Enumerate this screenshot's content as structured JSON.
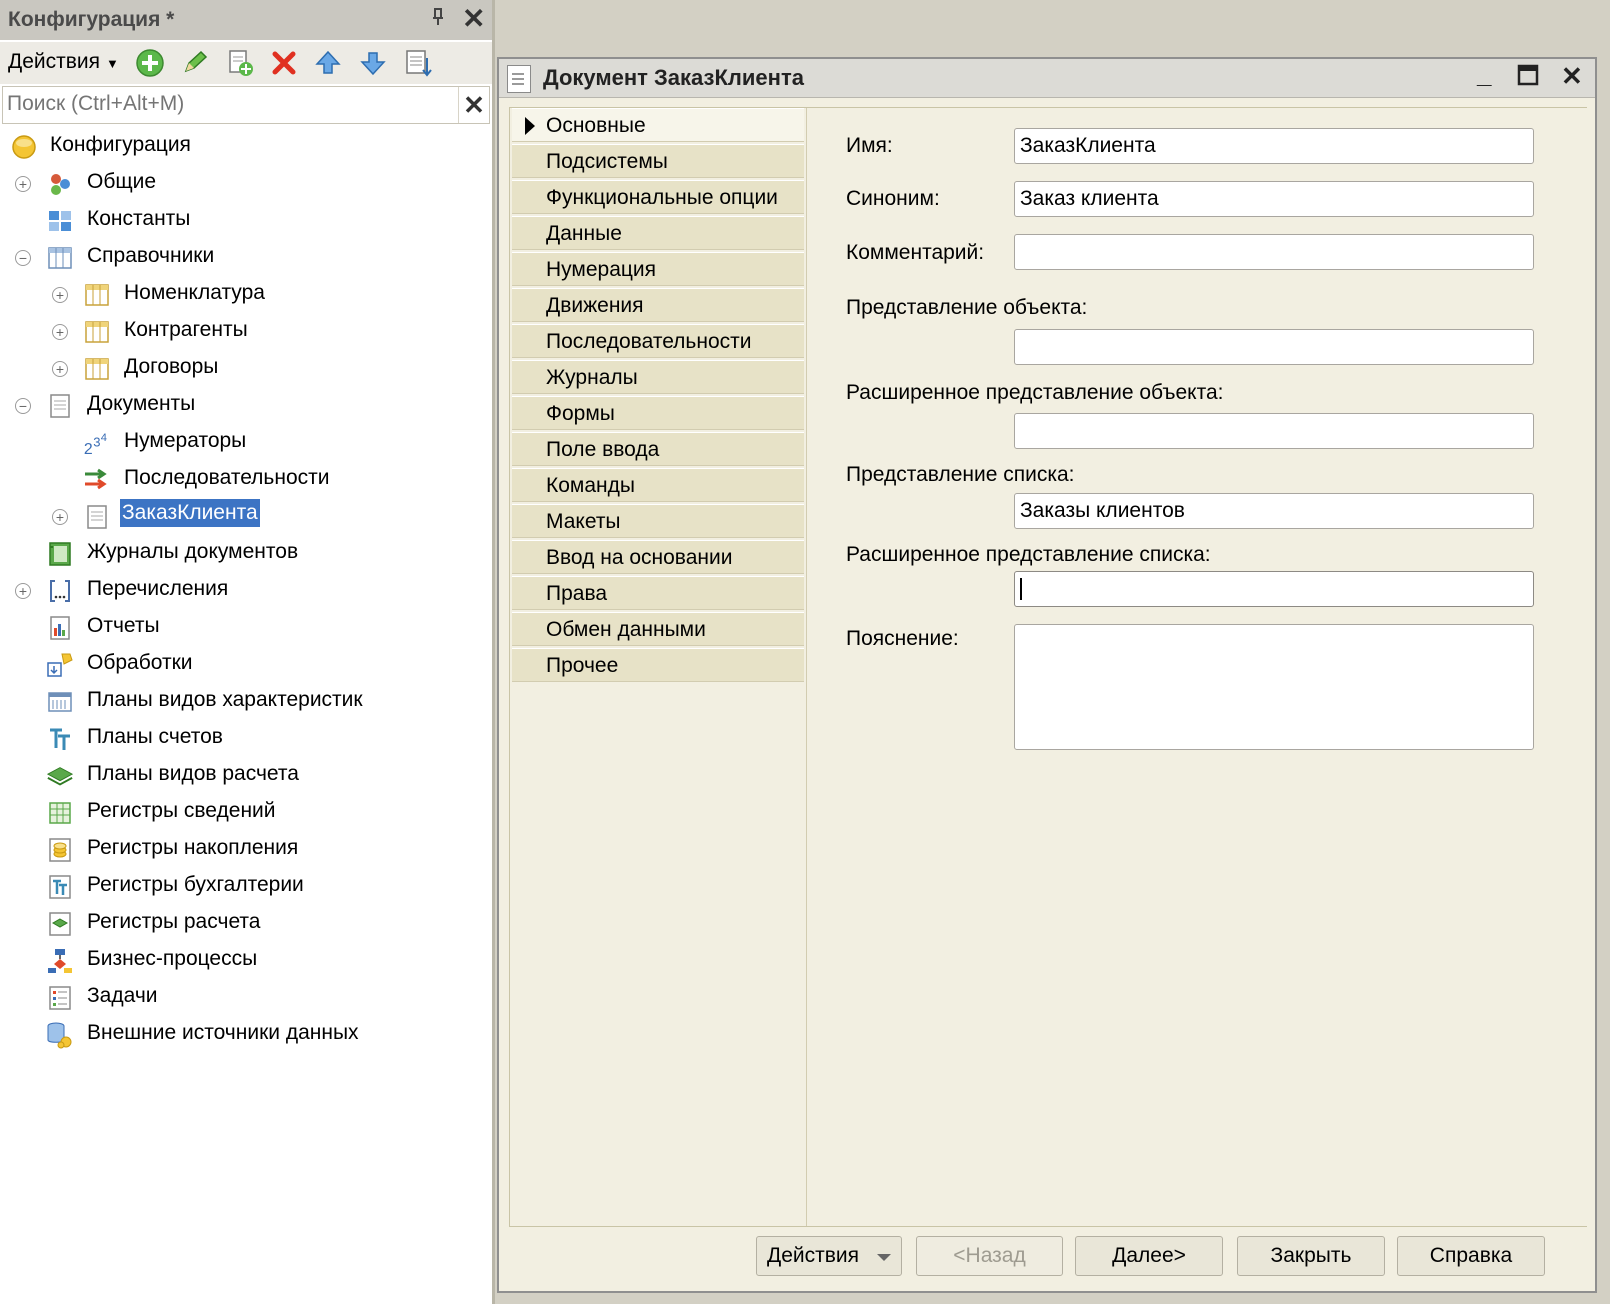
{
  "config_panel": {
    "title": "Конфигурация *",
    "toolbar": {
      "actions_label": "Действия",
      "icons": [
        "add-icon",
        "edit-icon",
        "copy-add-icon",
        "delete-icon",
        "move-up-icon",
        "move-down-icon",
        "sort-icon"
      ]
    },
    "search": {
      "placeholder": "Поиск (Ctrl+Alt+M)",
      "value": ""
    },
    "tree": [
      {
        "label": "Конфигурация",
        "icon": "configuration-icon",
        "level": 0,
        "expander": "none"
      },
      {
        "label": "Общие",
        "icon": "common-icon",
        "level": 1,
        "expander": "plus"
      },
      {
        "label": "Константы",
        "icon": "constants-icon",
        "level": 1,
        "expander": "none"
      },
      {
        "label": "Справочники",
        "icon": "catalogs-icon",
        "level": 1,
        "expander": "minus"
      },
      {
        "label": "Номенклатура",
        "icon": "catalog-icon",
        "level": 2,
        "expander": "plus"
      },
      {
        "label": "Контрагенты",
        "icon": "catalog-icon",
        "level": 2,
        "expander": "plus"
      },
      {
        "label": "Договоры",
        "icon": "catalog-icon",
        "level": 2,
        "expander": "plus"
      },
      {
        "label": "Документы",
        "icon": "documents-icon",
        "level": 1,
        "expander": "minus"
      },
      {
        "label": "Нумераторы",
        "icon": "numerators-icon",
        "level": 2,
        "expander": "none"
      },
      {
        "label": "Последовательности",
        "icon": "sequences-icon",
        "level": 2,
        "expander": "none"
      },
      {
        "label": "ЗаказКлиента",
        "icon": "document-icon",
        "level": 2,
        "expander": "plus",
        "selected": true
      },
      {
        "label": "Журналы документов",
        "icon": "journals-icon",
        "level": 1,
        "expander": "none"
      },
      {
        "label": "Перечисления",
        "icon": "enums-icon",
        "level": 1,
        "expander": "plus"
      },
      {
        "label": "Отчеты",
        "icon": "reports-icon",
        "level": 1,
        "expander": "none"
      },
      {
        "label": "Обработки",
        "icon": "dataprocessors-icon",
        "level": 1,
        "expander": "none"
      },
      {
        "label": "Планы видов характеристик",
        "icon": "chart-of-characteristic-types-icon",
        "level": 1,
        "expander": "none"
      },
      {
        "label": "Планы счетов",
        "icon": "charts-of-accounts-icon",
        "level": 1,
        "expander": "none"
      },
      {
        "label": "Планы видов расчета",
        "icon": "charts-of-calculation-types-icon",
        "level": 1,
        "expander": "none"
      },
      {
        "label": "Регистры сведений",
        "icon": "information-registers-icon",
        "level": 1,
        "expander": "none"
      },
      {
        "label": "Регистры накопления",
        "icon": "accumulation-registers-icon",
        "level": 1,
        "expander": "none"
      },
      {
        "label": "Регистры бухгалтерии",
        "icon": "accounting-registers-icon",
        "level": 1,
        "expander": "none"
      },
      {
        "label": "Регистры расчета",
        "icon": "calculation-registers-icon",
        "level": 1,
        "expander": "none"
      },
      {
        "label": "Бизнес-процессы",
        "icon": "business-processes-icon",
        "level": 1,
        "expander": "none"
      },
      {
        "label": "Задачи",
        "icon": "tasks-icon",
        "level": 1,
        "expander": "none"
      },
      {
        "label": "Внешние источники данных",
        "icon": "external-data-sources-icon",
        "level": 1,
        "expander": "none"
      }
    ]
  },
  "document_window": {
    "title": "Документ ЗаказКлиента",
    "tabs": [
      {
        "label": "Основные",
        "active": true
      },
      {
        "label": "Подсистемы"
      },
      {
        "label": "Функциональные опции"
      },
      {
        "label": "Данные"
      },
      {
        "label": "Нумерация"
      },
      {
        "label": "Движения"
      },
      {
        "label": "Последовательности"
      },
      {
        "label": "Журналы"
      },
      {
        "label": "Формы"
      },
      {
        "label": "Поле ввода"
      },
      {
        "label": "Команды"
      },
      {
        "label": "Макеты"
      },
      {
        "label": "Ввод на основании"
      },
      {
        "label": "Права"
      },
      {
        "label": "Обмен данными"
      },
      {
        "label": "Прочее"
      }
    ],
    "form": {
      "name_label": "Имя:",
      "name_value": "ЗаказКлиента",
      "synonym_label": "Синоним:",
      "synonym_value": "Заказ клиента",
      "comment_label": "Комментарий:",
      "comment_value": "",
      "object_presentation_label": "Представление объекта:",
      "object_presentation_value": "",
      "ext_object_presentation_label": "Расширенное представление объекта:",
      "ext_object_presentation_value": "",
      "list_presentation_label": "Представление списка:",
      "list_presentation_value": "Заказы клиентов",
      "ext_list_presentation_label": "Расширенное представление списка:",
      "ext_list_presentation_value": "",
      "explanation_label": "Пояснение:",
      "explanation_value": ""
    },
    "buttons": {
      "actions": "Действия",
      "back": "<Назад",
      "next": "Далее>",
      "close": "Закрыть",
      "help": "Справка"
    }
  }
}
